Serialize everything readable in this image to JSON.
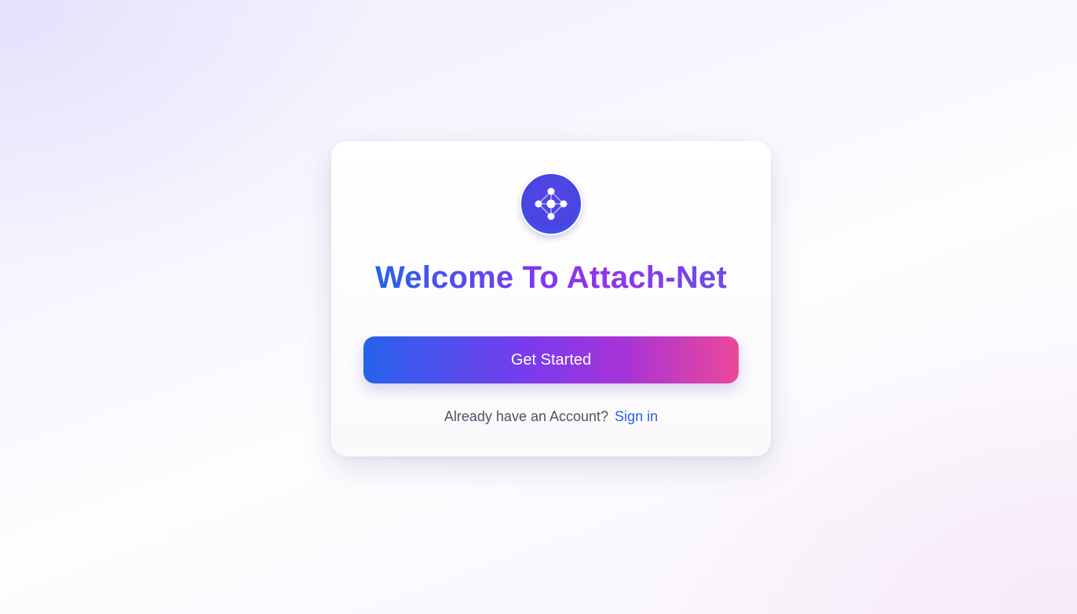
{
  "welcome": {
    "logo_icon": "network-nodes-icon",
    "title": "Welcome To Attach-Net",
    "cta_label": "Get Started",
    "account_prompt": "Already have an Account?",
    "signin_label": "Sign in"
  },
  "colors": {
    "brand_blue": "#2563eb",
    "brand_purple": "#7c3aed",
    "brand_pink": "#ec4899",
    "logo_bg": "#4f46e5",
    "muted_text": "#4b5563"
  }
}
